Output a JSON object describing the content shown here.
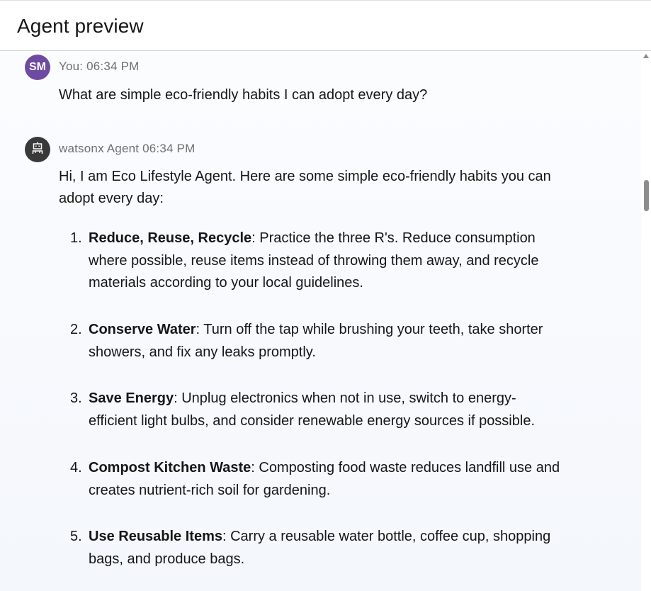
{
  "header": {
    "title": "Agent preview"
  },
  "messages": {
    "user": {
      "avatar_initials": "SM",
      "avatar_color": "#6e4aa0",
      "meta": "You: 06:34 PM",
      "text": "What are simple eco-friendly habits I can adopt every day?"
    },
    "agent": {
      "avatar_icon": "robot-icon",
      "avatar_color": "#393939",
      "meta": "watsonx Agent 06:34 PM",
      "intro": "Hi, I am Eco Lifestyle Agent. Here are some simple eco-friendly habits you can adopt every day:",
      "items": [
        {
          "number": "1.",
          "title": "Reduce, Reuse, Recycle",
          "line1": ": Practice the three R's. Reduce consumption",
          "line2": "where possible, reuse items instead of throwing them away, and recycle",
          "line3": "materials according to your local guidelines."
        },
        {
          "number": "2.",
          "title": "Conserve Water",
          "line1": ": Turn off the tap while brushing your teeth, take shorter",
          "line2": "showers, and fix any leaks promptly."
        },
        {
          "number": "3.",
          "title": "Save Energy",
          "line1": ": Unplug electronics when not in use, switch to energy-",
          "line2": "efficient light bulbs, and consider renewable energy sources if possible."
        },
        {
          "number": "4.",
          "title": "Compost Kitchen Waste",
          "line1": ": Composting food waste reduces landfill use and",
          "line2": "creates nutrient-rich soil for gardening."
        },
        {
          "number": "5.",
          "title": "Use Reusable Items",
          "line1": ": Carry a reusable water bottle, coffee cup, shopping",
          "line2": "bags, and produce bags."
        }
      ]
    }
  }
}
